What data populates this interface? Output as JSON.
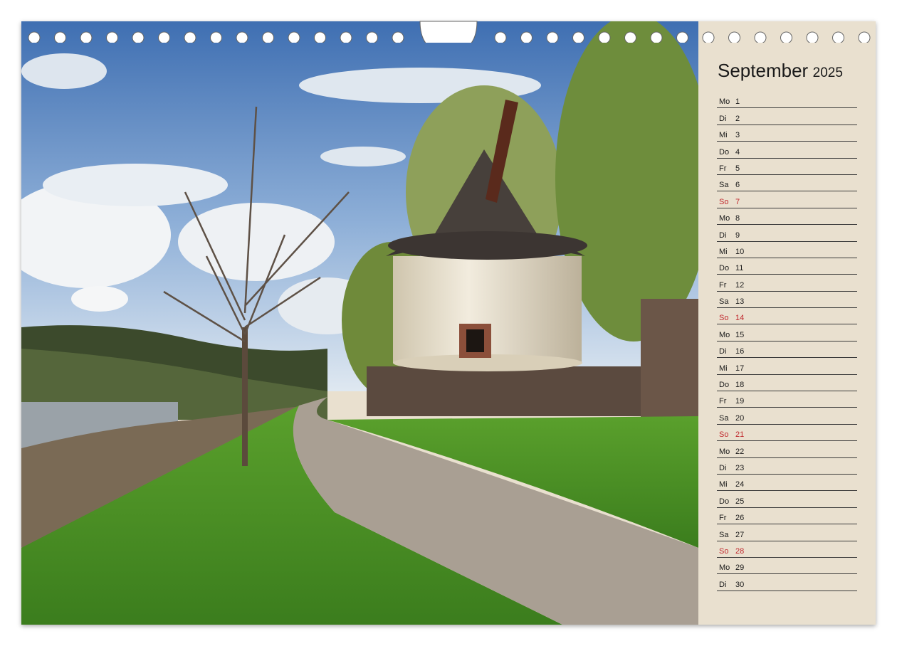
{
  "calendar": {
    "month": "September",
    "year": "2025",
    "days": [
      {
        "wd": "Mo",
        "d": "1",
        "sun": false
      },
      {
        "wd": "Di",
        "d": "2",
        "sun": false
      },
      {
        "wd": "Mi",
        "d": "3",
        "sun": false
      },
      {
        "wd": "Do",
        "d": "4",
        "sun": false
      },
      {
        "wd": "Fr",
        "d": "5",
        "sun": false
      },
      {
        "wd": "Sa",
        "d": "6",
        "sun": false
      },
      {
        "wd": "So",
        "d": "7",
        "sun": true
      },
      {
        "wd": "Mo",
        "d": "8",
        "sun": false
      },
      {
        "wd": "Di",
        "d": "9",
        "sun": false
      },
      {
        "wd": "Mi",
        "d": "10",
        "sun": false
      },
      {
        "wd": "Do",
        "d": "11",
        "sun": false
      },
      {
        "wd": "Fr",
        "d": "12",
        "sun": false
      },
      {
        "wd": "Sa",
        "d": "13",
        "sun": false
      },
      {
        "wd": "So",
        "d": "14",
        "sun": true
      },
      {
        "wd": "Mo",
        "d": "15",
        "sun": false
      },
      {
        "wd": "Di",
        "d": "16",
        "sun": false
      },
      {
        "wd": "Mi",
        "d": "17",
        "sun": false
      },
      {
        "wd": "Do",
        "d": "18",
        "sun": false
      },
      {
        "wd": "Fr",
        "d": "19",
        "sun": false
      },
      {
        "wd": "Sa",
        "d": "20",
        "sun": false
      },
      {
        "wd": "So",
        "d": "21",
        "sun": true
      },
      {
        "wd": "Mo",
        "d": "22",
        "sun": false
      },
      {
        "wd": "Di",
        "d": "23",
        "sun": false
      },
      {
        "wd": "Mi",
        "d": "24",
        "sun": false
      },
      {
        "wd": "Do",
        "d": "25",
        "sun": false
      },
      {
        "wd": "Fr",
        "d": "26",
        "sun": false
      },
      {
        "wd": "Sa",
        "d": "27",
        "sun": false
      },
      {
        "wd": "So",
        "d": "28",
        "sun": true
      },
      {
        "wd": "Mo",
        "d": "29",
        "sun": false
      },
      {
        "wd": "Di",
        "d": "30",
        "sun": false
      }
    ]
  },
  "colors": {
    "panel_bg": "#e9e0cf",
    "sunday": "#c0282d",
    "text": "#1a1a1a"
  }
}
